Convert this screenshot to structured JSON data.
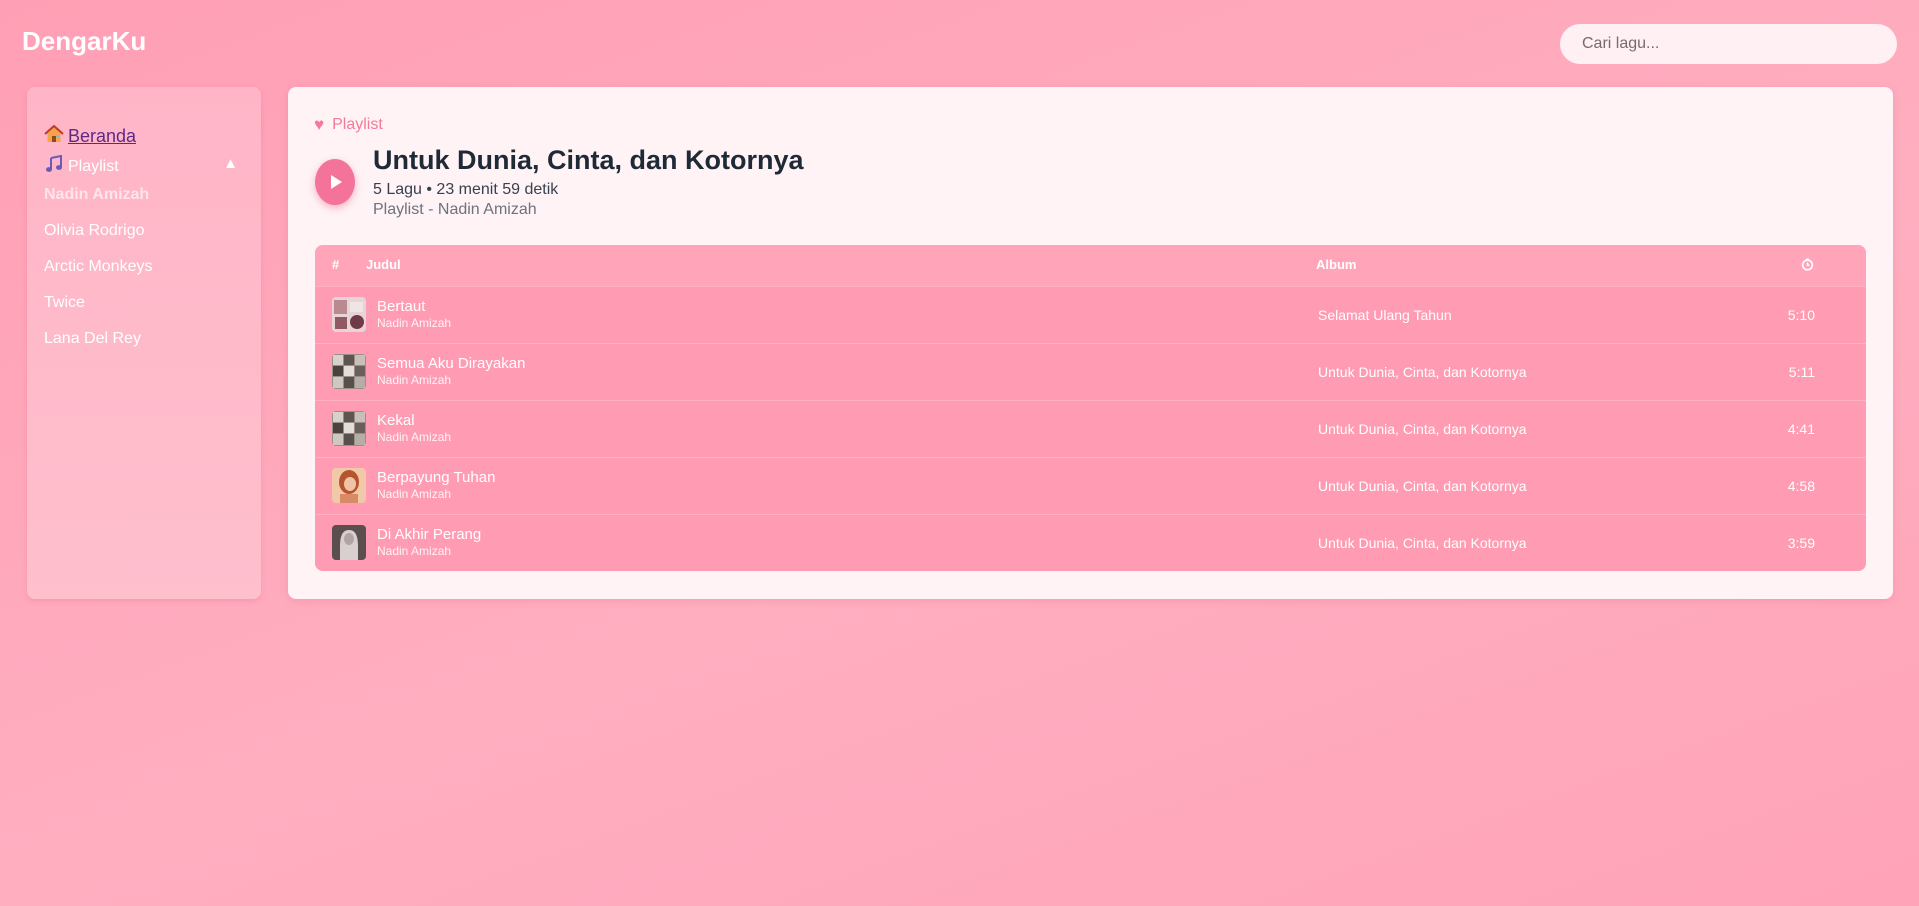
{
  "app": {
    "name": "DengarKu"
  },
  "search": {
    "placeholder": "Cari lagu..."
  },
  "sidebar": {
    "home_label": "Beranda",
    "playlist_label": "Playlist",
    "collapse_glyph": "▲",
    "artists": [
      "Nadin Amizah",
      "Olivia Rodrigo",
      "Arctic Monkeys",
      "Twice",
      "Lana Del Rey"
    ]
  },
  "playlist": {
    "tag": "Playlist",
    "title": "Untuk Dunia, Cinta, dan Kotornya",
    "meta": "5 Lagu • 23 menit 59 detik",
    "subtitle": "Playlist - Nadin Amizah"
  },
  "table": {
    "headers": {
      "number": "#",
      "title": "Judul",
      "album": "Album"
    },
    "rows": [
      {
        "title": "Bertaut",
        "artist": "Nadin Amizah",
        "album": "Selamat Ulang Tahun",
        "duration": "5:10"
      },
      {
        "title": "Semua Aku Dirayakan",
        "artist": "Nadin Amizah",
        "album": "Untuk Dunia, Cinta, dan Kotornya",
        "duration": "5:11"
      },
      {
        "title": "Kekal",
        "artist": "Nadin Amizah",
        "album": "Untuk Dunia, Cinta, dan Kotornya",
        "duration": "4:41"
      },
      {
        "title": "Berpayung Tuhan",
        "artist": "Nadin Amizah",
        "album": "Untuk Dunia, Cinta, dan Kotornya",
        "duration": "4:58"
      },
      {
        "title": "Di Akhir Perang",
        "artist": "Nadin Amizah",
        "album": "Untuk Dunia, Cinta, dan Kotornya",
        "duration": "3:59"
      }
    ]
  },
  "colors": {
    "accent": "#f4739a",
    "background": "#ffa3b8",
    "card": "#fff3f5"
  }
}
